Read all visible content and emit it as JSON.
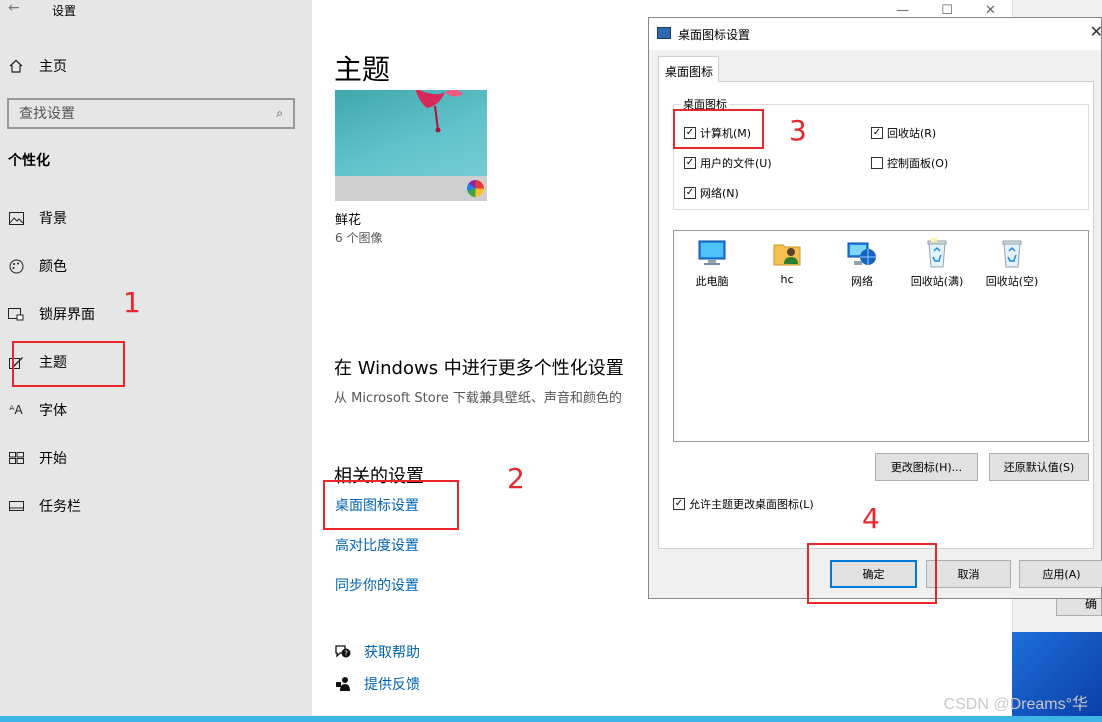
{
  "settings": {
    "window_title": "设置",
    "home_label": "主页",
    "search_placeholder": "查找设置",
    "section_heading": "个性化",
    "nav": [
      {
        "label": "背景",
        "icon": "image-icon"
      },
      {
        "label": "颜色",
        "icon": "palette-icon"
      },
      {
        "label": "锁屏界面",
        "icon": "lock-screen-icon"
      },
      {
        "label": "主题",
        "icon": "theme-brush-icon"
      },
      {
        "label": "字体",
        "icon": "font-icon"
      },
      {
        "label": "开始",
        "icon": "start-grid-icon"
      },
      {
        "label": "任务栏",
        "icon": "taskbar-icon"
      }
    ]
  },
  "main": {
    "title": "主题",
    "theme": {
      "name": "鲜花",
      "count": "6 个图像"
    },
    "more_heading": "在 Windows 中进行更多个性化设置",
    "more_desc": "从 Microsoft Store 下载兼具壁纸、声音和颜色的",
    "related_heading": "相关的设置",
    "links": [
      "桌面图标设置",
      "高对比度设置",
      "同步你的设置"
    ],
    "help": [
      {
        "label": "获取帮助",
        "icon": "help-chat-icon"
      },
      {
        "label": "提供反馈",
        "icon": "feedback-icon"
      }
    ]
  },
  "background_window": {
    "button_label": "确"
  },
  "dialog": {
    "title": "桌面图标设置",
    "tab": "桌面图标",
    "group_label": "桌面图标",
    "checkboxes": [
      {
        "label": "计算机(M)",
        "checked": true
      },
      {
        "label": "回收站(R)",
        "checked": true
      },
      {
        "label": "用户的文件(U)",
        "checked": true
      },
      {
        "label": "控制面板(O)",
        "checked": false
      },
      {
        "label": "网络(N)",
        "checked": true
      }
    ],
    "icons": [
      {
        "label": "此电脑",
        "icon": "this-pc-icon"
      },
      {
        "label": "hc",
        "icon": "user-folder-icon"
      },
      {
        "label": "网络",
        "icon": "network-icon"
      },
      {
        "label": "回收站(满)",
        "icon": "recycle-bin-full-icon"
      },
      {
        "label": "回收站(空)",
        "icon": "recycle-bin-empty-icon"
      }
    ],
    "change_icon_button": "更改图标(H)...",
    "restore_default_button": "还原默认值(S)",
    "allow_themes_label": "允许主题更改桌面图标(L)",
    "allow_themes_checked": true,
    "ok_button": "确定",
    "cancel_button": "取消",
    "apply_button": "应用(A)"
  },
  "annotations": {
    "step1": "1",
    "step2": "2",
    "step3": "3",
    "step4": "4"
  },
  "watermark": "CSDN @Dreams°华",
  "colors": {
    "link": "#0063b1",
    "annotation": "#e8262b",
    "sidebar_bg": "#e6e6e6",
    "dialog_bg": "#f0f0f0"
  }
}
